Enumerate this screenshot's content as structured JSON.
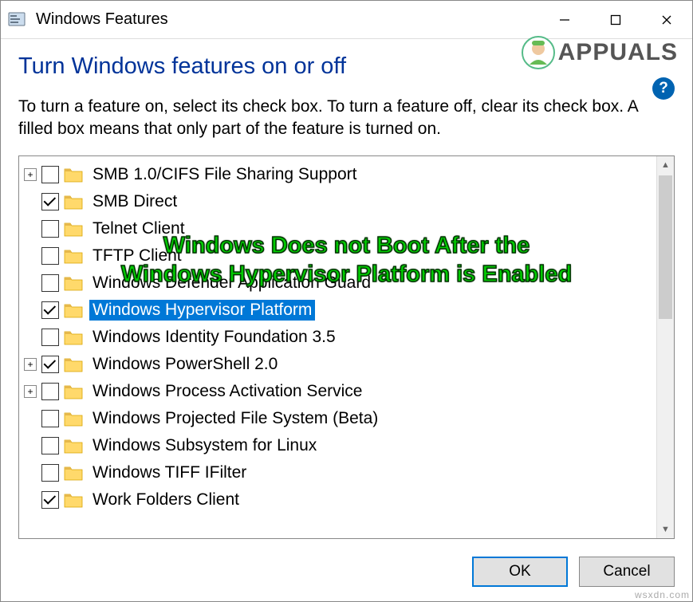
{
  "window": {
    "title": "Windows Features"
  },
  "watermark": "APPUALS",
  "heading": "Turn Windows features on or off",
  "description": "To turn a feature on, select its check box. To turn a feature off, clear its check box. A filled box means that only part of the feature is turned on.",
  "help_tooltip": "?",
  "overlay": {
    "line1": "Windows Does not Boot After the",
    "line2": "Windows Hypervisor Platform is Enabled"
  },
  "features": [
    {
      "expandable": true,
      "checked": false,
      "label": "SMB 1.0/CIFS File Sharing Support",
      "selected": false
    },
    {
      "expandable": false,
      "checked": true,
      "label": "SMB Direct",
      "selected": false
    },
    {
      "expandable": false,
      "checked": false,
      "label": "Telnet Client",
      "selected": false
    },
    {
      "expandable": false,
      "checked": false,
      "label": "TFTP Client",
      "selected": false
    },
    {
      "expandable": false,
      "checked": false,
      "label": "Windows Defender Application Guard",
      "selected": false
    },
    {
      "expandable": false,
      "checked": true,
      "label": "Windows Hypervisor Platform",
      "selected": true
    },
    {
      "expandable": false,
      "checked": false,
      "label": "Windows Identity Foundation 3.5",
      "selected": false
    },
    {
      "expandable": true,
      "checked": true,
      "label": "Windows PowerShell 2.0",
      "selected": false
    },
    {
      "expandable": true,
      "checked": false,
      "label": "Windows Process Activation Service",
      "selected": false
    },
    {
      "expandable": false,
      "checked": false,
      "label": "Windows Projected File System (Beta)",
      "selected": false
    },
    {
      "expandable": false,
      "checked": false,
      "label": "Windows Subsystem for Linux",
      "selected": false
    },
    {
      "expandable": false,
      "checked": false,
      "label": "Windows TIFF IFilter",
      "selected": false
    },
    {
      "expandable": false,
      "checked": true,
      "label": "Work Folders Client",
      "selected": false
    }
  ],
  "buttons": {
    "ok": "OK",
    "cancel": "Cancel"
  },
  "footer": "wsxdn.com"
}
